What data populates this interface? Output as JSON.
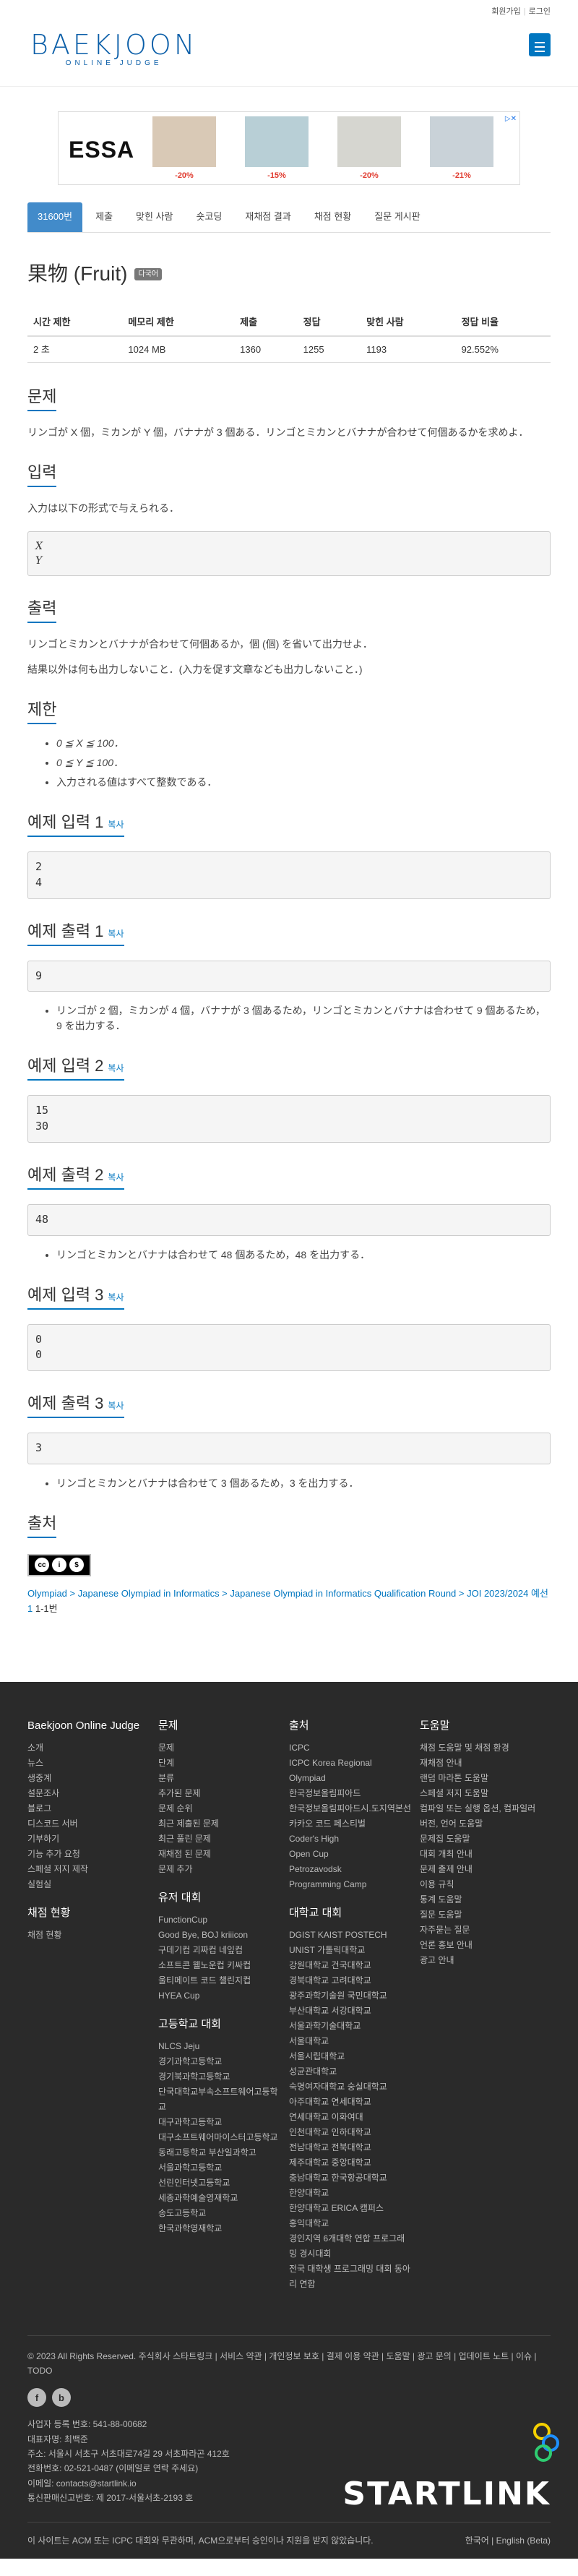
{
  "toplinks": {
    "signup": "회원가입",
    "login": "로그인"
  },
  "logo": {
    "main": "BAEKJOON",
    "sub": "ONLINE JUDGE"
  },
  "ad": {
    "brand": "ESSA",
    "discounts": [
      "-20%",
      "-15%",
      "-20%",
      "-21%"
    ]
  },
  "tabs": [
    "31600번",
    "제출",
    "맞힌 사람",
    "숏코딩",
    "재채점 결과",
    "채점 현황",
    "질문 게시판"
  ],
  "problem": {
    "title": "果物 (Fruit)",
    "badge": "다국어",
    "table_headers": [
      "시간 제한",
      "메모리 제한",
      "제출",
      "정답",
      "맞힌 사람",
      "정답 비율"
    ],
    "table_values": [
      "2 초",
      "1024 MB",
      "1360",
      "1255",
      "1193",
      "92.552%"
    ]
  },
  "sections": {
    "description_title": "문제",
    "description": "リンゴが X 個，ミカンが Y 個，バナナが 3 個ある．リンゴとミカンとバナナが合わせて何個あるかを求めよ．",
    "input_title": "입력",
    "input_text": "入力は以下の形式で与えられる．",
    "input_format": "X\nY",
    "output_title": "출력",
    "output_text1": "リンゴとミカンとバナナが合わせて何個あるか，個 (個) を省いて出力せよ．",
    "output_text2": "結果以外は何も出力しないこと．(入力を促す文章なども出力しないこと．)",
    "limit_title": "제한",
    "limits": [
      "0 ≦ X ≦ 100．",
      "0 ≦ Y ≦ 100．",
      "入力される値はすべて整数である．"
    ],
    "copy": "복사",
    "sample_in_1_title": "예제 입력 1",
    "sample_in_1": "2\n4",
    "sample_out_1_title": "예제 출력 1",
    "sample_out_1": "9",
    "sample_note_1": "リンゴが 2 個，ミカンが 4 個，バナナが 3 個あるため，リンゴとミカンとバナナは合わせて 9 個あるため，9 を出力する．",
    "sample_in_2_title": "예제 입력 2",
    "sample_in_2": "15\n30",
    "sample_out_2_title": "예제 출력 2",
    "sample_out_2": "48",
    "sample_note_2": "リンゴとミカンとバナナは合わせて 48 個あるため，48 を出力する．",
    "sample_in_3_title": "예제 입력 3",
    "sample_in_3": "0\n0",
    "sample_out_3_title": "예제 출력 3",
    "sample_out_3": "3",
    "sample_note_3": "リンゴとミカンとバナナは合わせて 3 個あるため，3 を出力する．",
    "source_title": "출처",
    "crumbs": [
      "Olympiad",
      "Japanese Olympiad in Informatics",
      "Japanese Olympiad in Informatics Qualification Round",
      "JOI 2023/2024 예선 1"
    ],
    "crumb_tail": "1-1번"
  },
  "footer": {
    "col1_title": "Baekjoon Online Judge",
    "col1": [
      "소개",
      "뉴스",
      "생중계",
      "설문조사",
      "블로그",
      "디스코드 서버",
      "기부하기",
      "기능 추가 요청",
      "스페셜 저지 제작",
      "실험실"
    ],
    "col1b_title": "채점 현황",
    "col1b": [
      "채점 현황"
    ],
    "col2_title": "문제",
    "col2": [
      "문제",
      "단계",
      "분류",
      "추가된 문제",
      "문제 순위",
      "최근 제출된 문제",
      "최근 풀린 문제",
      "재채점 된 문제",
      "문제 추가"
    ],
    "col2b_title": "유저 대회",
    "col2b": [
      "FunctionCup",
      "Good Bye, BOJ kriiicon",
      "구데기컵 괴짜컵 네잎컵",
      "소프트콘 웰노운컵 키싸컵",
      "울티메이트 코드 챌린지컵",
      "HYEA Cup"
    ],
    "col2c_title": "고등학교 대회",
    "col2c": [
      "NLCS Jeju",
      "경기과학고등학교",
      "경기북과학고등학교",
      "단국대학교부속소프트웨어고등학교",
      "대구과학고등학교",
      "대구소프트웨어마이스터고등학교",
      "동래고등학교 부산일과학고",
      "서울과학고등학교",
      "선린인터넷고등학교",
      "세종과학예술영재학교",
      "송도고등학교",
      "한국과학영재학교"
    ],
    "col3_title": "출처",
    "col3": [
      "ICPC",
      "ICPC Korea Regional",
      "Olympiad",
      "한국정보올림피아드",
      "한국정보올림피아드시.도지역본선",
      "카카오 코드 페스티벌",
      "Coder's High",
      "Open Cup",
      "Petrozavodsk",
      "Programming Camp"
    ],
    "col3b_title": "대학교 대회",
    "col3b": [
      "DGIST KAIST POSTECH UNIST 가톨릭대학교",
      "강원대학교 건국대학교",
      "경북대학교 고려대학교",
      "광주과학기술원 국민대학교",
      "부산대학교 서강대학교",
      "서울과학기술대학교",
      "서울대학교",
      "서울시립대학교",
      "성균관대학교",
      "숙명여자대학교 숭실대학교",
      "아주대학교 연세대학교",
      "연세대학교 이화여대",
      "인천대학교 인하대학교",
      "전남대학교 전북대학교",
      "제주대학교 중앙대학교",
      "충남대학교 한국항공대학교",
      "한양대학교",
      "한양대학교 ERICA 캠퍼스",
      "홍익대학교",
      "경인지역 6개대학 연합 프로그래밍 경시대회",
      "전국 대학생 프로그래밍 대회 동아리 연합"
    ],
    "col4_title": "도움말",
    "col4": [
      "채점 도움말 및 채점 환경",
      "재채점 안내",
      "랜덤 마라톤 도움말",
      "스페셜 저지 도움말",
      "컴파일 또는 실행 옵션, 컴파일러 버전, 언어 도움말",
      "문제집 도움말",
      "대회 개최 안내",
      "문제 출제 안내",
      "이용 규칙",
      "통계 도움말",
      "질문 도움말",
      "자주묻는 질문",
      "언론 홍보 안내",
      "광고 안내"
    ],
    "bottom_links": "© 2023 All Rights Reserved. 주식회사 스타트링크 | 서비스 약관 | 개인정보 보호 | 결제 이용 약관 | 도움말 | 광고 문의 | 업데이트 노트 | 이슈 | TODO",
    "company": [
      "사업자 등록 번호: 541-88-00682",
      "대표자명: 최백준",
      "주소: 서울시 서초구 서초대로74길 29 서초파라곤 412호",
      "전화번호: 02-521-0487 (이메일로 연락 주세요)",
      "이메일: contacts@startlink.io",
      "통신판매신고번호: 제 2017-서울서초-2193 호"
    ],
    "startlink": "STARTLINK",
    "disclaimer": "이 사이트는 ACM 또는 ICPC 대회와 무관하며, ACM으로부터 승인이나 지원을 받지 않았습니다.",
    "lang": "한국어 | English (Beta)"
  }
}
